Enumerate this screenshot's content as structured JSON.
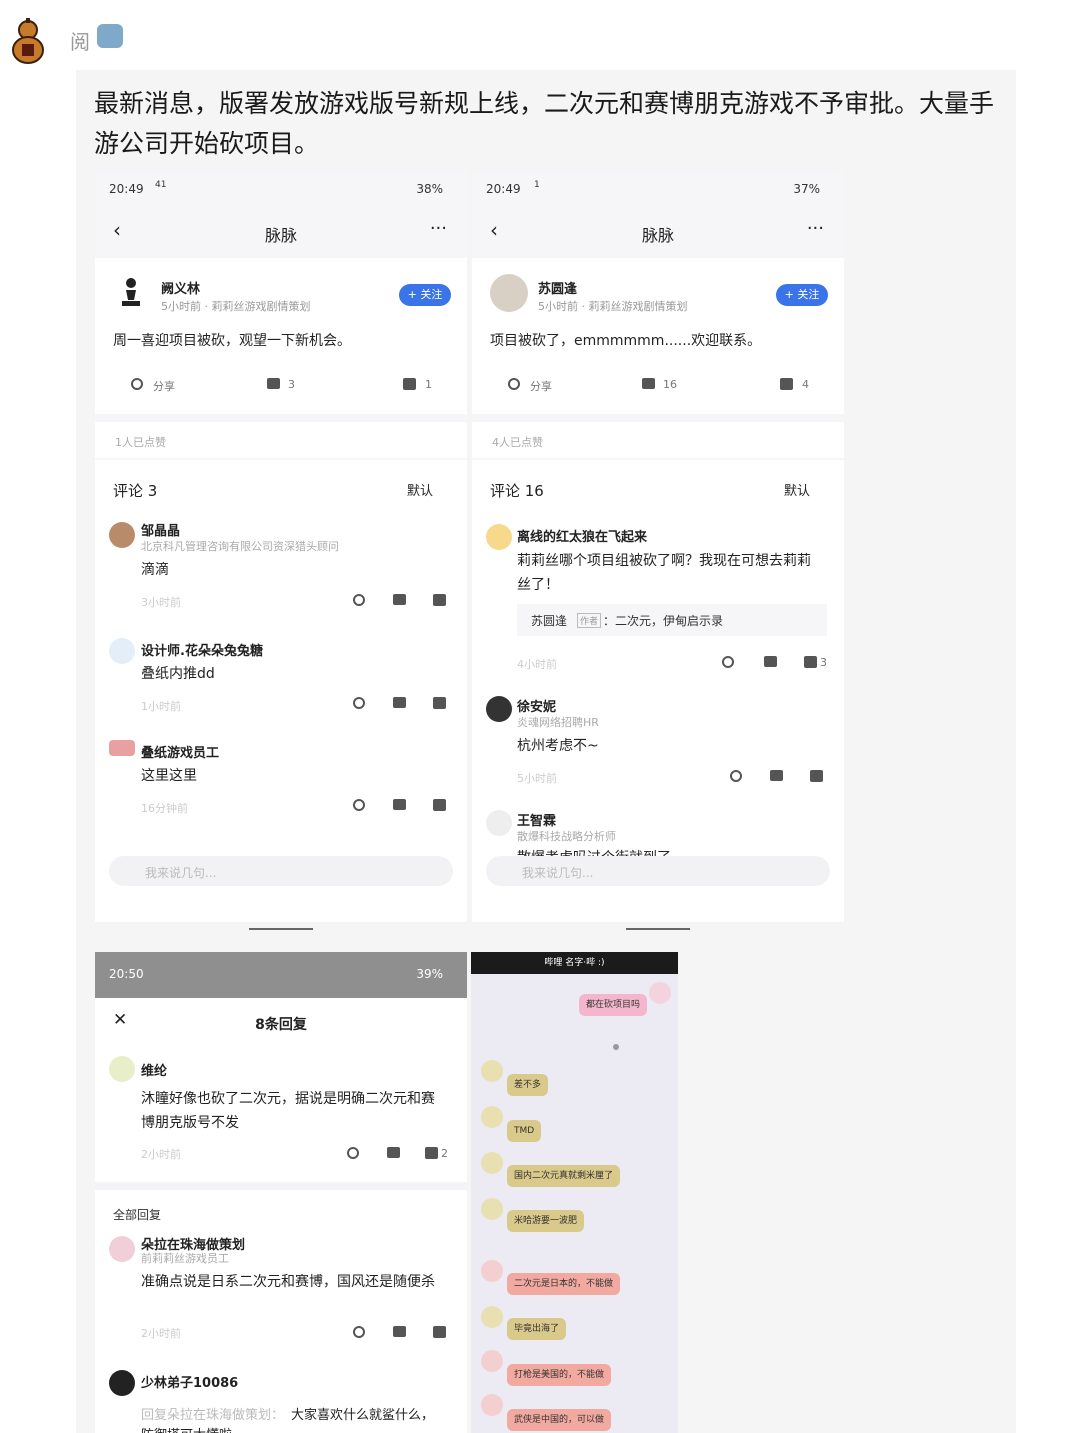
{
  "header": {
    "username": "阅"
  },
  "post": {
    "text": "最新消息，版署发放游戏版号新规上线，二次元和赛博朋克游戏不予审批。大量手游公司开始砍项目。"
  },
  "shot1": {
    "time": "20:49",
    "speed": "41",
    "battery": "38%",
    "nav_title": "脉脉",
    "back": "‹",
    "more": "···",
    "author": "阙义林",
    "meta": "5小时前 · 莉莉丝游戏剧情策划",
    "follow": "+ 关注",
    "content": "周一喜迎项目被砍，观望一下新机会。",
    "share": "分享",
    "comments": "3",
    "likes": "1",
    "liked": "1人已点赞",
    "comment_title": "评论 3",
    "sort": "默认",
    "c1_name": "邹晶晶",
    "c1_meta": "北京科凡管理咨询有限公司资深猎头顾问",
    "c1_body": "滴滴",
    "c1_time": "3小时前",
    "c2_name": "设计师.花朵朵兔兔糖",
    "c2_body": "叠纸内推dd",
    "c2_time": "1小时前",
    "c3_name": "叠纸游戏员工",
    "c3_body": "这里这里",
    "c3_time": "16分钟前",
    "input": "我来说几句..."
  },
  "shot2": {
    "time": "20:49",
    "speed": "1",
    "battery": "37%",
    "nav_title": "脉脉",
    "back": "‹",
    "more": "···",
    "author": "苏圆逢",
    "meta": "5小时前 · 莉莉丝游戏剧情策划",
    "follow": "+ 关注",
    "content": "项目被砍了，emmmmmm......欢迎联系。",
    "share": "分享",
    "comments": "16",
    "likes": "4",
    "liked": "4人已点赞",
    "comment_title": "评论 16",
    "sort": "默认",
    "c1_name": "离线的红太狼在飞起来",
    "c1_body_1": "莉莉丝哪个项目组被砍了啊？我现在可想去莉莉",
    "c1_body_2": "丝了！",
    "c1_reply_name": "苏圆逢",
    "c1_reply_tag": "作者",
    "c1_reply": "：二次元，伊甸启示录",
    "c1_time": "4小时前",
    "c1_likes": "3",
    "c2_name": "徐安妮",
    "c2_meta": "炎魂网络招聘HR",
    "c2_body": "杭州考虑不~",
    "c2_time": "5小时前",
    "c3_name": "王智霖",
    "c3_meta": "散爆科技战略分析师",
    "c3_body": "散爆考虑吗过个街就到了",
    "input": "我来说几句..."
  },
  "shot3": {
    "time": "20:50",
    "battery": "39%",
    "title": "8条回复",
    "close": "✕",
    "r1_name": "维纶",
    "r1_body_1": "沐瞳好像也砍了二次元，据说是明确二次元和赛",
    "r1_body_2": "博朋克版号不发",
    "r1_time": "2小时前",
    "r1_likes": "2",
    "all_replies": "全部回复",
    "r2_name": "朵拉在珠海做策划",
    "r2_meta": "前莉莉丝游戏员工",
    "r2_body": "准确点说是日系二次元和赛博，国风还是随便杀",
    "r2_time": "2小时前",
    "r3_name": "少林弟子10086",
    "r3_prefix": "回复朵拉在珠海做策划：",
    "r3_body": "大家喜欢什么就鲨什么，",
    "r3_body_2": "防御塔可太懂啦"
  },
  "shot4": {
    "topbar": "哔哩 名字·哔 :)",
    "bubbles": [
      "都在砍项目吗",
      "差不多",
      "TMD",
      "国内二次元真就剩米厘了",
      "米哈游要一波肥",
      "二次元是日本的，不能做",
      "毕竟出海了",
      "打枪是美国的，不能做",
      "武侠是中国的，可以做"
    ],
    "colors": {
      "pink": "#f4b6cc",
      "olive": "#d9c98a",
      "red": "#f1a9a0"
    }
  }
}
